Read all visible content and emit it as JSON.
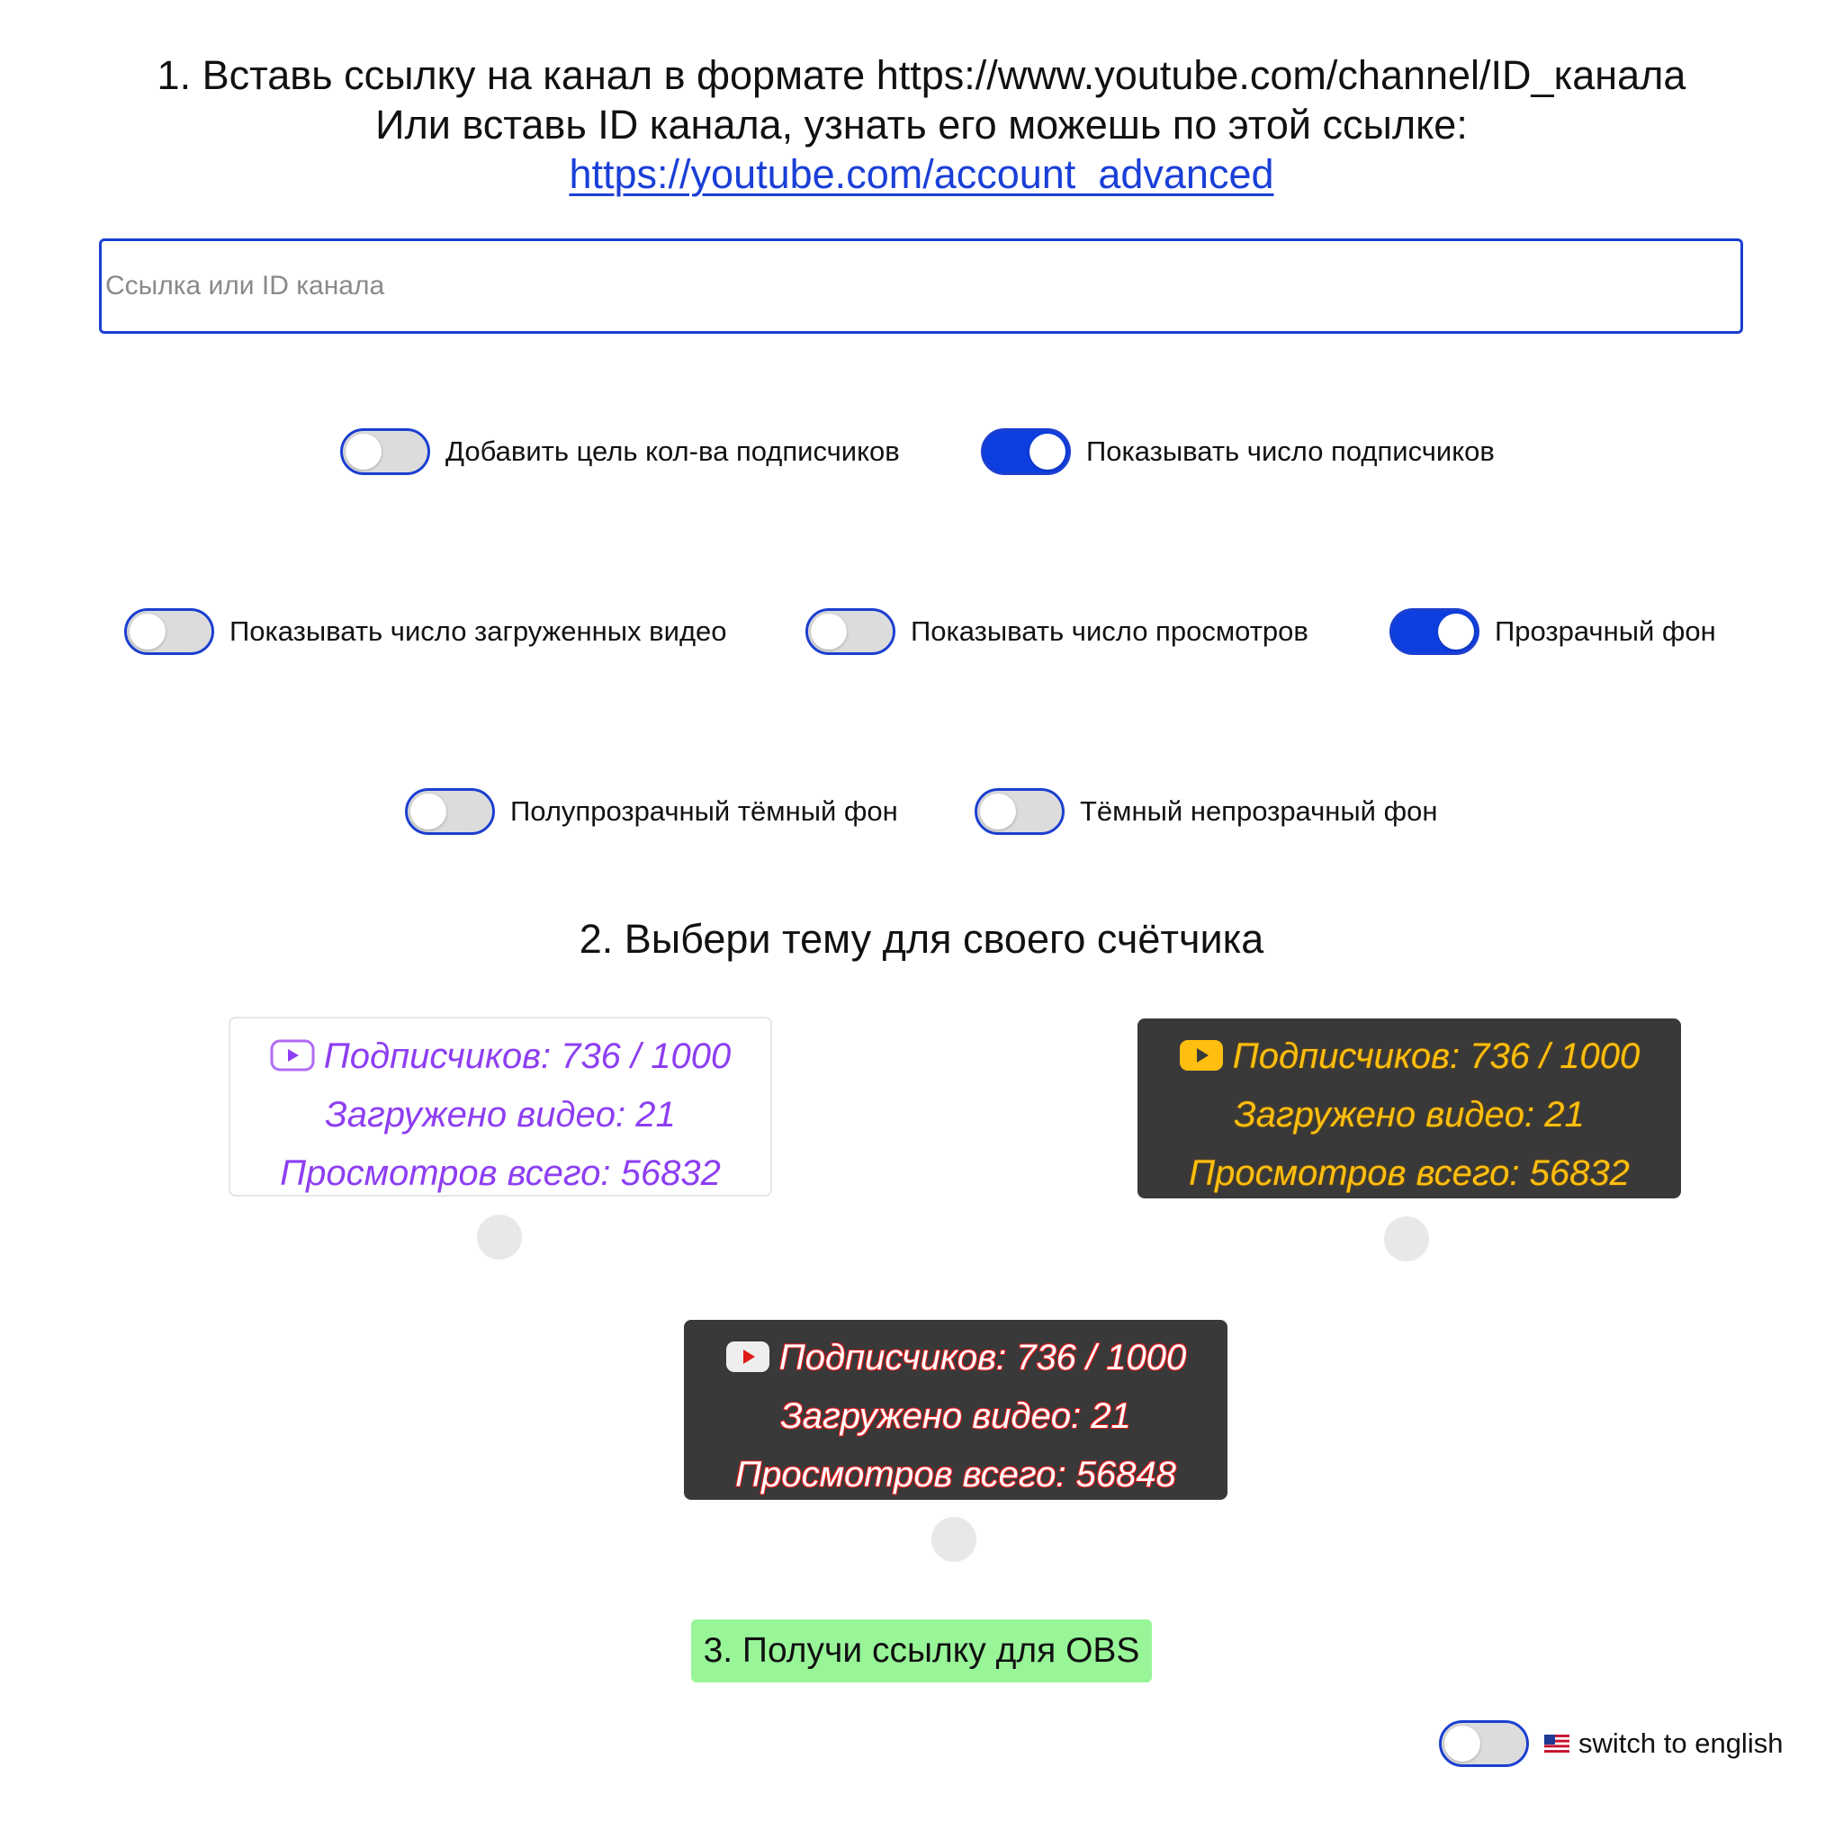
{
  "step1": {
    "line1": "1. Вставь ссылку на канал в формате https://www.youtube.com/channel/ID_канала",
    "line2": "Или вставь ID канала, узнать его можешь по этой ссылке:",
    "link_text": "https://youtube.com/account_advanced",
    "input_placeholder": "Ссылка или ID канала",
    "input_value": ""
  },
  "toggles": [
    {
      "label": "Добавить цель кол-ва подписчиков",
      "on": false
    },
    {
      "label": "Показывать число подписчиков",
      "on": true
    },
    {
      "label": "Показывать число загруженных видео",
      "on": false
    },
    {
      "label": "Показывать число просмотров",
      "on": false
    },
    {
      "label": "Прозрачный фон",
      "on": true
    },
    {
      "label": "Полупрозрачный тёмный фон",
      "on": false
    },
    {
      "label": "Тёмный непрозрачный фон",
      "on": false
    }
  ],
  "step2": {
    "title": "2. Выбери тему для своего счётчика",
    "themes": [
      {
        "subscribers": "Подписчиков: 736 / 1000",
        "videos": "Загружено видео: 21",
        "views": "Просмотров всего: 56832",
        "icon": "youtube-outline-icon",
        "color": "#8d3ef2"
      },
      {
        "subscribers": "Подписчиков: 736 / 1000",
        "videos": "Загружено видео: 21",
        "views": "Просмотров всего: 56832",
        "icon": "youtube-gold-icon",
        "color": "#ffbf10"
      },
      {
        "subscribers": "Подписчиков: 736 / 1000",
        "videos": "Загружено видео: 21",
        "views": "Просмотров всего: 56848",
        "icon": "youtube-red-icon",
        "color": "#ffffff"
      }
    ]
  },
  "step3": {
    "button_label": "3. Получи ссылку для OBS",
    "button_color": "#98f598"
  },
  "language": {
    "label": "switch to english",
    "flag": "us-flag-icon",
    "on": false
  },
  "colors": {
    "accent": "#1c3fd0",
    "toggle_on": "#0d3ee0",
    "link": "#1a3fd8"
  }
}
